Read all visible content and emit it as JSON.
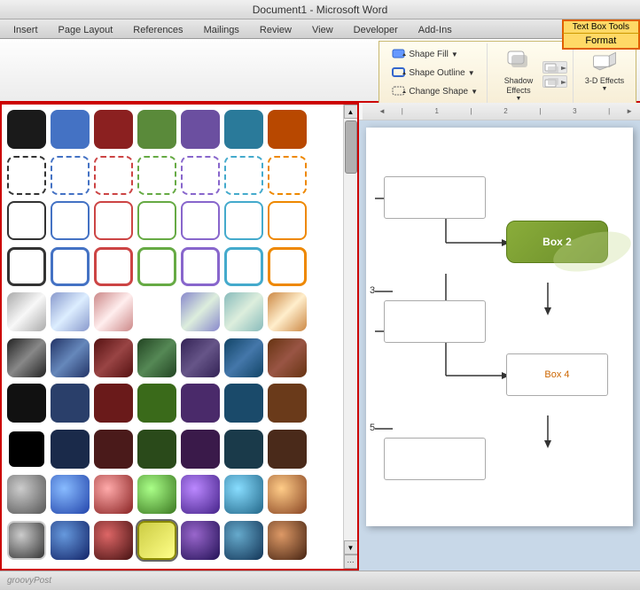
{
  "titleBar": {
    "text": "Document1 - Microsoft Word"
  },
  "tabs": [
    {
      "label": "Insert"
    },
    {
      "label": "Page Layout"
    },
    {
      "label": "References"
    },
    {
      "label": "Mailings"
    },
    {
      "label": "Review"
    },
    {
      "label": "View"
    },
    {
      "label": "Developer"
    },
    {
      "label": "Add-Ins"
    }
  ],
  "contextTab": {
    "header": "Text Box Tools",
    "sub": "Format"
  },
  "ribbon": {
    "shapeFill": "Shape Fill",
    "shapeOutline": "Shape Outline",
    "changeShape": "Change Shape",
    "shadowEffects": "Shadow Effects",
    "shadowEffectsLabel": "Shadow Effects",
    "threeDEffects": "3-D Effects",
    "expandIcon": "▼"
  },
  "shapes": {
    "rows": [
      [
        {
          "type": "solid",
          "color": "#1a1a1a",
          "border": "none"
        },
        {
          "type": "solid",
          "color": "#4472c4",
          "border": "none"
        },
        {
          "type": "solid",
          "color": "#8b2020",
          "border": "none"
        },
        {
          "type": "solid",
          "color": "#5a8a3a",
          "border": "none"
        },
        {
          "type": "solid",
          "color": "#6b4fa0",
          "border": "none"
        },
        {
          "type": "solid",
          "color": "#2a7a9a",
          "border": "none"
        },
        {
          "type": "solid",
          "color": "#b84800",
          "border": "none"
        },
        {
          "type": "none",
          "color": "transparent",
          "border": "none"
        }
      ],
      [
        {
          "type": "dashed",
          "color": "transparent",
          "border": "2px dashed #333"
        },
        {
          "type": "dashed",
          "color": "transparent",
          "border": "2px dashed #4472c4"
        },
        {
          "type": "dashed",
          "color": "transparent",
          "border": "2px dashed #cc4444"
        },
        {
          "type": "dashed",
          "color": "transparent",
          "border": "2px dashed #66aa44"
        },
        {
          "type": "dashed",
          "color": "transparent",
          "border": "2px dashed #8866cc"
        },
        {
          "type": "dashed",
          "color": "transparent",
          "border": "2px dashed #44aacc"
        },
        {
          "type": "dashed",
          "color": "transparent",
          "border": "2px dashed #ee8800"
        },
        {
          "type": "none",
          "color": "transparent",
          "border": "none"
        }
      ],
      [
        {
          "type": "outline",
          "color": "white",
          "border": "2px solid #333"
        },
        {
          "type": "outline",
          "color": "white",
          "border": "2px solid #4472c4"
        },
        {
          "type": "outline",
          "color": "white",
          "border": "2px solid #cc4444"
        },
        {
          "type": "outline",
          "color": "white",
          "border": "2px solid #66aa44"
        },
        {
          "type": "outline",
          "color": "white",
          "border": "2px solid #8866cc"
        },
        {
          "type": "outline",
          "color": "white",
          "border": "2px solid #44aacc"
        },
        {
          "type": "outline",
          "color": "white",
          "border": "2px solid #ee8800"
        },
        {
          "type": "none",
          "color": "transparent",
          "border": "none"
        }
      ],
      [
        {
          "type": "outline-thick",
          "color": "white",
          "border": "3px solid #333"
        },
        {
          "type": "outline-thick",
          "color": "white",
          "border": "3px solid #4472c4"
        },
        {
          "type": "outline-thick",
          "color": "white",
          "border": "3px solid #cc4444"
        },
        {
          "type": "outline-thick",
          "color": "white",
          "border": "3px solid #66aa44"
        },
        {
          "type": "outline-thick",
          "color": "white",
          "border": "3px solid #8866cc"
        },
        {
          "type": "outline-thick",
          "color": "white",
          "border": "3px solid #44aacc"
        },
        {
          "type": "outline-thick",
          "color": "white",
          "border": "3px solid #ee8800"
        },
        {
          "type": "none",
          "color": "transparent",
          "border": "none"
        }
      ],
      [
        {
          "type": "gradient",
          "color": "#cccccc",
          "border": "none",
          "gradient": "linear-gradient(135deg,#aaa,#f8f8f8,#aaa)"
        },
        {
          "type": "gradient",
          "color": "#bbccee",
          "border": "none",
          "gradient": "linear-gradient(135deg,#8899cc,#ddeeff,#8899cc)"
        },
        {
          "type": "gradient",
          "color": "#eecccc",
          "border": "none",
          "gradient": "linear-gradient(135deg,#cc8888,#ffeeee,#cc8888)"
        },
        {
          "type": "gradient",
          "color": "#cceecc",
          "border": "none",
          "gradient": "linear-gradient(135deg,#88bb88,#ddffd,#88bb88)"
        },
        {
          "type": "gradient",
          "color": "#ccccee",
          "border": "none",
          "gradient": "linear-gradient(135deg,#8888cc,#ddeedd,#8888cc)"
        },
        {
          "type": "gradient",
          "color": "#cceeee",
          "border": "none",
          "gradient": "linear-gradient(135deg,#88bbbb,#ddeedd,#88bbbb)"
        },
        {
          "type": "gradient",
          "color": "#eeccaa",
          "border": "none",
          "gradient": "linear-gradient(135deg,#cc8844,#ffeecc,#cc8844)"
        },
        {
          "type": "none",
          "color": "transparent",
          "border": "none"
        }
      ],
      [
        {
          "type": "gradient-dark",
          "color": "#555",
          "border": "none",
          "gradient": "linear-gradient(135deg,#222,#888,#222)"
        },
        {
          "type": "gradient-dark",
          "color": "#334477",
          "border": "none",
          "gradient": "linear-gradient(135deg,#223366,#6688bb,#223366)"
        },
        {
          "type": "gradient-dark",
          "color": "#662222",
          "border": "none",
          "gradient": "linear-gradient(135deg,#551111,#994444,#551111)"
        },
        {
          "type": "gradient-dark",
          "color": "#336633",
          "border": "none",
          "gradient": "linear-gradient(135deg,#224422,#558855,#224422)"
        },
        {
          "type": "gradient-dark",
          "color": "#443366",
          "border": "none",
          "gradient": "linear-gradient(135deg,#332255,#665588,#332255)"
        },
        {
          "type": "gradient-dark",
          "color": "#225577",
          "border": "none",
          "gradient": "linear-gradient(135deg,#114466,#4477aa,#114466)"
        },
        {
          "type": "gradient-dark",
          "color": "#884422",
          "border": "none",
          "gradient": "linear-gradient(135deg,#663311,#995544,#663311)"
        },
        {
          "type": "none",
          "color": "transparent",
          "border": "none"
        }
      ],
      [
        {
          "type": "solid-dark",
          "color": "#111",
          "border": "none"
        },
        {
          "type": "solid-dark",
          "color": "#2a3f6a",
          "border": "none"
        },
        {
          "type": "solid-dark",
          "color": "#6a1a1a",
          "border": "none"
        },
        {
          "type": "solid-dark",
          "color": "#3a6a1a",
          "border": "none"
        },
        {
          "type": "solid-dark",
          "color": "#4a2a6a",
          "border": "none"
        },
        {
          "type": "solid-dark",
          "color": "#1a4a6a",
          "border": "none"
        },
        {
          "type": "solid-dark",
          "color": "#6a3a1a",
          "border": "none"
        },
        {
          "type": "none",
          "color": "transparent",
          "border": "none"
        }
      ],
      [
        {
          "type": "solid-black",
          "color": "#000",
          "border": "2px solid #fff"
        },
        {
          "type": "solid-dark2",
          "color": "#1a2a4a",
          "border": "none"
        },
        {
          "type": "solid-dark2",
          "color": "#4a1a1a",
          "border": "none"
        },
        {
          "type": "solid-dark2",
          "color": "#2a4a1a",
          "border": "none"
        },
        {
          "type": "solid-dark2",
          "color": "#3a1a4a",
          "border": "none"
        },
        {
          "type": "solid-dark2",
          "color": "#1a3a4a",
          "border": "none"
        },
        {
          "type": "solid-dark2",
          "color": "#4a2a1a",
          "border": "none"
        },
        {
          "type": "none",
          "color": "transparent",
          "border": "none"
        }
      ],
      [
        {
          "type": "gradient-shiny",
          "color": "#777",
          "border": "none",
          "gradient": "radial-gradient(circle at 35% 35%, #ccc, #555)"
        },
        {
          "type": "gradient-shiny",
          "color": "#3a6aaa",
          "border": "none",
          "gradient": "radial-gradient(circle at 35% 35%, #88bbff, #2244aa)"
        },
        {
          "type": "gradient-shiny",
          "color": "#aa3a3a",
          "border": "none",
          "gradient": "radial-gradient(circle at 35% 35%, #ffaaaa, #882222)"
        },
        {
          "type": "gradient-shiny",
          "color": "#6aaa3a",
          "border": "none",
          "gradient": "radial-gradient(circle at 35% 35%, #aaff88, #3a7720)"
        },
        {
          "type": "gradient-shiny",
          "color": "#6a3aaa",
          "border": "none",
          "gradient": "radial-gradient(circle at 35% 35%, #bb88ff, #442288)"
        },
        {
          "type": "gradient-shiny",
          "color": "#3a8aaa",
          "border": "none",
          "gradient": "radial-gradient(circle at 35% 35%, #88ddff, #226688)"
        },
        {
          "type": "gradient-shiny",
          "color": "#aa6a3a",
          "border": "none",
          "gradient": "radial-gradient(circle at 35% 35%, #ffcc88, #884422)"
        },
        {
          "type": "none",
          "color": "transparent",
          "border": "none"
        }
      ],
      [
        {
          "type": "gradient-shiny2",
          "color": "#555",
          "border": "2px solid #ccc",
          "gradient": "radial-gradient(circle at 35% 35%, #ccc, #333)"
        },
        {
          "type": "gradient-shiny2",
          "color": "#2a4a8a",
          "border": "none",
          "gradient": "radial-gradient(circle at 35% 35%, #6699dd, #112266)"
        },
        {
          "type": "gradient-shiny2",
          "color": "#8a2a2a",
          "border": "none",
          "gradient": "radial-gradient(circle at 35% 35%, #dd6666, #441111)"
        },
        {
          "type": "selected-yellow",
          "color": "#aaaa22",
          "border": "2px solid #888800",
          "gradient": "linear-gradient(135deg,#cccc44,#ffff88)"
        },
        {
          "type": "gradient-shiny2",
          "color": "#4a2a7a",
          "border": "none",
          "gradient": "radial-gradient(circle at 35% 35%, #9966cc, #221155)"
        },
        {
          "type": "gradient-shiny2",
          "color": "#2a6a8a",
          "border": "none",
          "gradient": "radial-gradient(circle at 35% 35%, #66aacc, #113355)"
        },
        {
          "type": "gradient-shiny2",
          "color": "#8a4a2a",
          "border": "none",
          "gradient": "radial-gradient(circle at 35% 35%, #dd9966, #442211)"
        },
        {
          "type": "none",
          "color": "transparent",
          "border": "none"
        }
      ]
    ]
  },
  "diagram": {
    "box2Label": "Box 2",
    "box4Label": "Box 4",
    "lineNumber3": "3",
    "lineNumber5": "5",
    "accentColor": "#8aad3a"
  },
  "statusBar": {
    "logo": "groovyPost"
  }
}
